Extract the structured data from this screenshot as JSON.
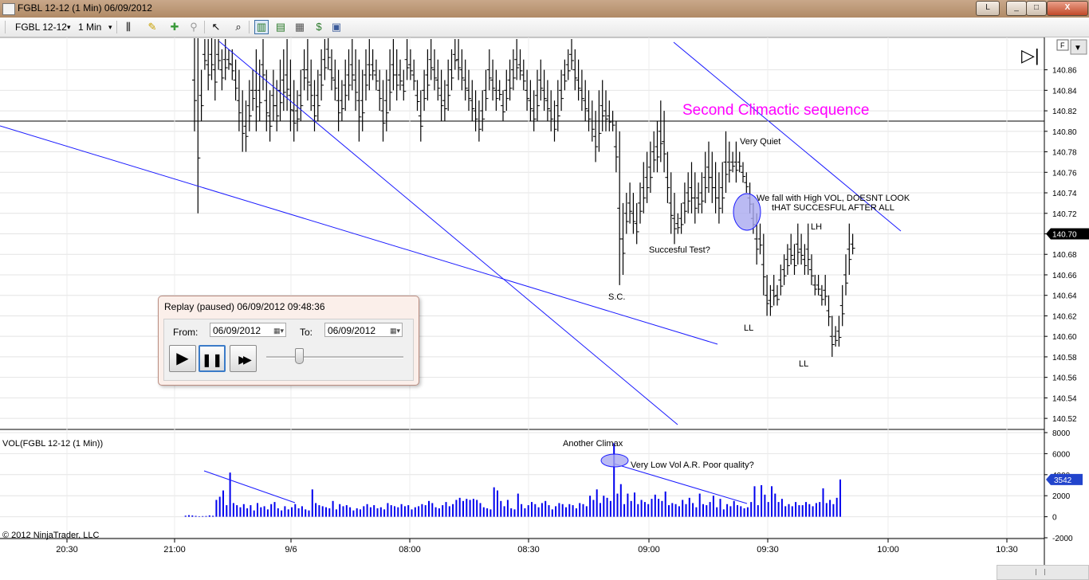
{
  "window": {
    "title": "FGBL 12-12 (1 Min)  06/09/2012",
    "buttons": [
      "L",
      "_",
      "□",
      "X"
    ]
  },
  "toolbar": {
    "instrument": "FGBL 12-12",
    "interval": "1 Min",
    "dropdown_glyph": "▾",
    "icons": [
      "bars-icon",
      "pencil-icon",
      "plus-icon",
      "pin-icon",
      "pointer-icon",
      "zoom-icon",
      "chart-trader-icon",
      "data-box-icon",
      "performance-icon",
      "dollar-icon",
      "properties-icon"
    ]
  },
  "chart_data": [
    {
      "type": "ohlc",
      "panel": "price",
      "ylim": [
        140.51,
        140.89
      ],
      "y_ticks": [
        "140.86",
        "140.84",
        "140.82",
        "140.80",
        "140.78",
        "140.76",
        "140.74",
        "140.72",
        "140.70",
        "140.68",
        "140.66",
        "140.64",
        "140.62",
        "140.60",
        "140.58",
        "140.56",
        "140.54",
        "140.52"
      ],
      "last_price": "140.70",
      "horizontal_line": 140.81,
      "bars_start_time": "21:00",
      "bars": [
        [
          140.9,
          140.8,
          0
        ],
        [
          140.9,
          140.72,
          1
        ],
        [
          140.86,
          140.81,
          2
        ],
        [
          140.89,
          140.86,
          3
        ],
        [
          140.89,
          140.84,
          4
        ],
        [
          140.9,
          140.85,
          5
        ],
        [
          140.89,
          140.83,
          6
        ],
        [
          140.89,
          140.86,
          7
        ],
        [
          140.88,
          140.84,
          8
        ],
        [
          140.89,
          140.85,
          9
        ],
        [
          140.88,
          140.86,
          10
        ],
        [
          140.88,
          140.85,
          11
        ],
        [
          140.87,
          140.83,
          12
        ],
        [
          140.86,
          140.8,
          13
        ],
        [
          140.84,
          140.78,
          14
        ],
        [
          140.83,
          140.78,
          15
        ],
        [
          140.85,
          140.8,
          16
        ],
        [
          140.86,
          140.82,
          17
        ],
        [
          140.88,
          140.8,
          18
        ],
        [
          140.87,
          140.81,
          19
        ],
        [
          140.89,
          140.84,
          20
        ],
        [
          140.86,
          140.8,
          21
        ],
        [
          140.84,
          140.79,
          22
        ],
        [
          140.86,
          140.81,
          23
        ],
        [
          140.85,
          140.8,
          24
        ],
        [
          140.87,
          140.81,
          25
        ],
        [
          140.88,
          140.82,
          26
        ],
        [
          140.89,
          140.82,
          27
        ],
        [
          140.87,
          140.8,
          28
        ],
        [
          140.85,
          140.79,
          29
        ],
        [
          140.84,
          140.8,
          30
        ],
        [
          140.86,
          140.81,
          31
        ],
        [
          140.88,
          140.84,
          32
        ],
        [
          140.89,
          140.83,
          33
        ],
        [
          140.87,
          140.82,
          34
        ],
        [
          140.85,
          140.8,
          35
        ],
        [
          140.86,
          140.81,
          36
        ],
        [
          140.88,
          140.83,
          37
        ],
        [
          140.89,
          140.85,
          38
        ],
        [
          140.9,
          140.86,
          39
        ],
        [
          140.88,
          140.84,
          40
        ],
        [
          140.87,
          140.83,
          41
        ],
        [
          140.86,
          140.8,
          42
        ],
        [
          140.85,
          140.81,
          43
        ],
        [
          140.87,
          140.82,
          44
        ],
        [
          140.88,
          140.83,
          45
        ],
        [
          140.89,
          140.84,
          46
        ],
        [
          140.88,
          140.82,
          47
        ],
        [
          140.87,
          140.79,
          48
        ],
        [
          140.86,
          140.8,
          49
        ],
        [
          140.88,
          140.83,
          50
        ],
        [
          140.89,
          140.84,
          51
        ],
        [
          140.88,
          140.85,
          52
        ],
        [
          140.87,
          140.84,
          53
        ],
        [
          140.86,
          140.82,
          54
        ],
        [
          140.85,
          140.79,
          55
        ],
        [
          140.86,
          140.8,
          56
        ],
        [
          140.88,
          140.82,
          57
        ],
        [
          140.89,
          140.84,
          58
        ],
        [
          140.88,
          140.83,
          59
        ],
        [
          140.87,
          140.84,
          60
        ],
        [
          140.86,
          140.83,
          61
        ],
        [
          140.89,
          140.85,
          62
        ],
        [
          140.88,
          140.85,
          63
        ],
        [
          140.87,
          140.84,
          64
        ],
        [
          140.85,
          140.82,
          65
        ],
        [
          140.84,
          140.79,
          66
        ],
        [
          140.86,
          140.82,
          67
        ],
        [
          140.88,
          140.83,
          68
        ],
        [
          140.89,
          140.85,
          69
        ],
        [
          140.88,
          140.84,
          70
        ],
        [
          140.87,
          140.83,
          71
        ],
        [
          140.86,
          140.81,
          72
        ],
        [
          140.85,
          140.81,
          73
        ],
        [
          140.87,
          140.82,
          74
        ],
        [
          140.88,
          140.84,
          75
        ],
        [
          140.89,
          140.86,
          76
        ],
        [
          140.89,
          140.85,
          77
        ],
        [
          140.88,
          140.84,
          78
        ],
        [
          140.87,
          140.83,
          79
        ],
        [
          140.86,
          140.82,
          80
        ],
        [
          140.85,
          140.81,
          81
        ],
        [
          140.84,
          140.8,
          82
        ],
        [
          140.83,
          140.79,
          83
        ],
        [
          140.84,
          140.8,
          84
        ],
        [
          140.86,
          140.82,
          85
        ],
        [
          140.88,
          140.84,
          86
        ],
        [
          140.87,
          140.83,
          87
        ],
        [
          140.86,
          140.82,
          88
        ],
        [
          140.85,
          140.83,
          89
        ],
        [
          140.84,
          140.81,
          90
        ],
        [
          140.86,
          140.82,
          91
        ],
        [
          140.87,
          140.83,
          92
        ],
        [
          140.88,
          140.84,
          93
        ],
        [
          140.89,
          140.85,
          94
        ],
        [
          140.88,
          140.85,
          95
        ],
        [
          140.87,
          140.84,
          96
        ],
        [
          140.86,
          140.82,
          97
        ],
        [
          140.85,
          140.81,
          98
        ],
        [
          140.84,
          140.8,
          99
        ],
        [
          140.86,
          140.81,
          100
        ],
        [
          140.87,
          140.83,
          101
        ],
        [
          140.86,
          140.82,
          102
        ],
        [
          140.85,
          140.81,
          103
        ],
        [
          140.84,
          140.8,
          104
        ],
        [
          140.83,
          140.79,
          105
        ],
        [
          140.85,
          140.8,
          106
        ],
        [
          140.86,
          140.82,
          107
        ],
        [
          140.87,
          140.84,
          108
        ],
        [
          140.88,
          140.85,
          109
        ],
        [
          140.89,
          140.86,
          110
        ],
        [
          140.88,
          140.84,
          111
        ],
        [
          140.87,
          140.83,
          112
        ],
        [
          140.86,
          140.82,
          113
        ],
        [
          140.85,
          140.81,
          114
        ],
        [
          140.84,
          140.8,
          115
        ],
        [
          140.83,
          140.79,
          116
        ],
        [
          140.82,
          140.77,
          117
        ],
        [
          140.84,
          140.78,
          118
        ],
        [
          140.85,
          140.8,
          119
        ],
        [
          140.84,
          140.8,
          120
        ],
        [
          140.83,
          140.8,
          121
        ],
        [
          140.82,
          140.8,
          122
        ],
        [
          140.81,
          140.76,
          123
        ],
        [
          140.8,
          140.65,
          124
        ],
        [
          140.73,
          140.66,
          125
        ],
        [
          140.74,
          140.7,
          126
        ],
        [
          140.75,
          140.71,
          127
        ],
        [
          140.74,
          140.7,
          128
        ],
        [
          140.73,
          140.69,
          129
        ],
        [
          140.75,
          140.71,
          130
        ],
        [
          140.77,
          140.72,
          131
        ],
        [
          140.78,
          140.73,
          132
        ],
        [
          140.79,
          140.74,
          133
        ],
        [
          140.8,
          140.76,
          134
        ],
        [
          140.81,
          140.76,
          135
        ],
        [
          140.83,
          140.77,
          136
        ],
        [
          140.82,
          140.76,
          137
        ],
        [
          140.78,
          140.73,
          138
        ],
        [
          140.76,
          140.7,
          139
        ],
        [
          140.74,
          140.69,
          140
        ],
        [
          140.72,
          140.7,
          141
        ],
        [
          140.73,
          140.7,
          142
        ],
        [
          140.75,
          140.71,
          143
        ],
        [
          140.76,
          140.72,
          144
        ],
        [
          140.77,
          140.72,
          145
        ],
        [
          140.76,
          140.71,
          146
        ],
        [
          140.75,
          140.72,
          147
        ],
        [
          140.76,
          140.72,
          148
        ],
        [
          140.78,
          140.73,
          149
        ],
        [
          140.79,
          140.74,
          150
        ],
        [
          140.78,
          140.73,
          151
        ],
        [
          140.77,
          140.72,
          152
        ],
        [
          140.76,
          140.71,
          153
        ],
        [
          140.77,
          140.72,
          154
        ],
        [
          140.8,
          140.74,
          155
        ],
        [
          140.79,
          140.75,
          156
        ],
        [
          140.78,
          140.76,
          157
        ],
        [
          140.79,
          140.75,
          158
        ],
        [
          140.78,
          140.76,
          159
        ],
        [
          140.77,
          140.75,
          160
        ],
        [
          140.76,
          140.74,
          161
        ],
        [
          140.75,
          140.72,
          162
        ],
        [
          140.73,
          140.7,
          163
        ],
        [
          140.72,
          140.67,
          164
        ],
        [
          140.71,
          140.68,
          165
        ],
        [
          140.7,
          140.64,
          166
        ],
        [
          140.66,
          140.62,
          167
        ],
        [
          140.65,
          140.62,
          168
        ],
        [
          140.66,
          140.63,
          169
        ],
        [
          140.65,
          140.63,
          170
        ],
        [
          140.67,
          140.64,
          171
        ],
        [
          140.68,
          140.65,
          172
        ],
        [
          140.69,
          140.66,
          173
        ],
        [
          140.7,
          140.67,
          174
        ],
        [
          140.69,
          140.66,
          175
        ],
        [
          140.71,
          140.67,
          176
        ],
        [
          140.7,
          140.67,
          177
        ],
        [
          140.69,
          140.66,
          178
        ],
        [
          140.71,
          140.66,
          179
        ],
        [
          140.68,
          140.65,
          180
        ],
        [
          140.66,
          140.64,
          181
        ],
        [
          140.66,
          140.64,
          182
        ],
        [
          140.65,
          140.63,
          183
        ],
        [
          140.66,
          140.63,
          184
        ],
        [
          140.64,
          140.61,
          185
        ],
        [
          140.62,
          140.58,
          186
        ],
        [
          140.61,
          140.59,
          187
        ],
        [
          140.62,
          140.59,
          188
        ],
        [
          140.65,
          140.61,
          189
        ],
        [
          140.68,
          140.64,
          190
        ],
        [
          140.71,
          140.66,
          191
        ],
        [
          140.7,
          140.68,
          192
        ]
      ],
      "annotations": [
        {
          "text": "Second Climactic sequence",
          "color": "#ff00ff"
        },
        {
          "text": "Very Quiet"
        },
        {
          "text": "We fall with High VOL, DOESNT LOOK"
        },
        {
          "text": "tHAT SUCCESFUL AFTER ALL"
        },
        {
          "text": "LH"
        },
        {
          "text": "Succesful Test?"
        },
        {
          "text": "S.C."
        },
        {
          "text": "LL"
        },
        {
          "text": "LL"
        }
      ]
    },
    {
      "type": "bar",
      "panel": "volume",
      "title": "VOL(FGBL 12-12 (1 Min))",
      "ylim": [
        -2000,
        8000
      ],
      "y_ticks": [
        "8000",
        "6000",
        "4000",
        "2000",
        "0",
        "-2000"
      ],
      "last_value": "3542",
      "annotations": [
        {
          "text": "Another Climax"
        },
        {
          "text": "Very Low Vol A.R. Poor quality?"
        }
      ],
      "volumes": [
        100,
        150,
        120,
        80,
        50,
        60,
        70,
        130,
        90,
        1600,
        1900,
        2500,
        1100,
        4200,
        1300,
        1100,
        900,
        1200,
        800,
        1100,
        600,
        1300,
        900,
        1000,
        700,
        1200,
        1400,
        800,
        600,
        1000,
        700,
        900,
        1200,
        800,
        1000,
        700,
        600,
        2600,
        1300,
        1100,
        1000,
        900,
        800,
        1500,
        700,
        1200,
        1000,
        1100,
        900,
        600,
        800,
        700,
        1000,
        1200,
        900,
        1100,
        800,
        900,
        700,
        1300,
        1100,
        1000,
        900,
        1200,
        1000,
        1100,
        700,
        900,
        1000,
        1200,
        1100,
        1500,
        1300,
        900,
        800,
        1100,
        1400,
        1000,
        1200,
        1600,
        1800,
        1500,
        1700,
        1600,
        1700,
        1600,
        1300,
        900,
        800,
        700,
        2800,
        2500,
        1500,
        1000,
        1600,
        800,
        700,
        2200,
        1200,
        800,
        1100,
        1400,
        1200,
        900,
        1300,
        1500,
        1100,
        700,
        1000,
        1300,
        1200,
        900,
        1200,
        1100,
        800,
        1300,
        1200,
        1000,
        2000,
        1600,
        2600,
        1300,
        2000,
        1800,
        1500,
        7000,
        2200,
        3100,
        1200,
        2200,
        1500,
        2300,
        1200,
        1600,
        1400,
        1200,
        1700,
        2100,
        1700,
        1500,
        2400,
        1100,
        1300,
        1200,
        1000,
        1600,
        1200,
        1800,
        1300,
        900,
        2200,
        1200,
        1100,
        1400,
        2000,
        900,
        1700,
        700,
        1200,
        1000,
        1500,
        1100,
        1000,
        800,
        900,
        1400,
        2900,
        1100,
        3000,
        2100,
        1400,
        2900,
        2200,
        1400,
        1700,
        1000,
        1200,
        1000,
        1400,
        1100,
        1100,
        1400,
        1200,
        1000,
        1300,
        1400,
        2700,
        1300,
        1600,
        1200,
        1800,
        3542
      ],
      "time_axis": [
        "20:30",
        "21:00",
        "9/6",
        "08:00",
        "08:30",
        "09:00",
        "09:30",
        "10:00",
        "10:30"
      ]
    }
  ],
  "copyright": "© 2012 NinjaTrader, LLC",
  "replay": {
    "title": "Replay (paused) 06/09/2012 09:48:36",
    "from_label": "From:",
    "from_value": "06/09/2012",
    "to_label": "To:",
    "to_value": "06/09/2012",
    "calendar_glyph": "▦▾",
    "play_glyph": "▶",
    "pause_glyph": "❚❚",
    "ff_glyph": "▶▶",
    "speed_fraction": 0.24
  },
  "side_glyphs": {
    "f": "F",
    "menu": "▼",
    "end": "▷|"
  },
  "colors": {
    "trendline": "#1a1aff",
    "magenta": "#ff00ff",
    "volume": "#0000ee",
    "ellipse_fill": "#a9a9f0"
  }
}
